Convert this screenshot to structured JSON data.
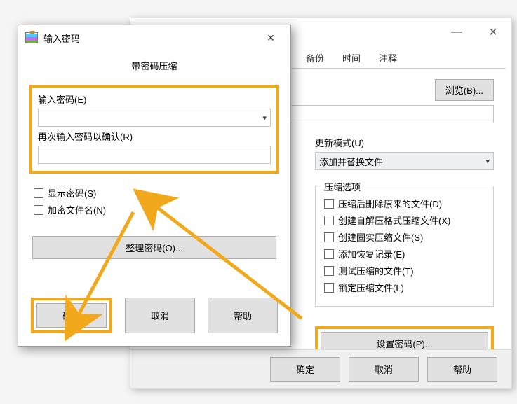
{
  "front": {
    "title": "输入密码",
    "subtitle": "带密码压缩",
    "pw_label": "输入密码(E)",
    "confirm_label": "再次输入密码以确认(R)",
    "show_pw": "显示密码(S)",
    "encrypt_names": "加密文件名(N)",
    "organize": "整理密码(O)...",
    "ok": "确定",
    "cancel": "取消",
    "help": "帮助"
  },
  "back": {
    "tabs": {
      "backup": "备份",
      "time": "时间",
      "comment": "注释"
    },
    "browse": "浏览(B)...",
    "update_label": "更新模式(U)",
    "update_value": "添加并替换文件",
    "group_title": "压缩选项",
    "opts": {
      "del_after": "压缩后删除原来的文件(D)",
      "sfx": "创建自解压格式压缩文件(X)",
      "solid": "创建固实压缩文件(S)",
      "recovery": "添加恢复记录(E)",
      "test": "测试压缩的文件(T)",
      "lock": "锁定压缩文件(L)"
    },
    "set_pw": "设置密码(P)...",
    "ok": "确定",
    "cancel": "取消",
    "help": "帮助"
  }
}
